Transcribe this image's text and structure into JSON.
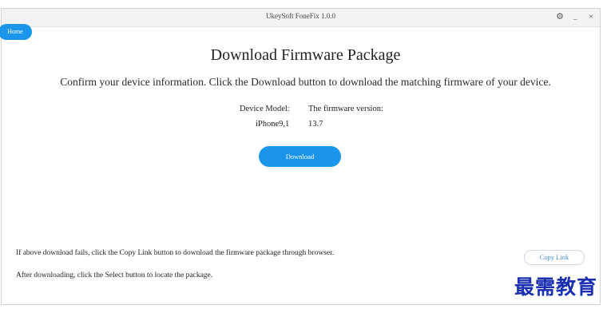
{
  "window": {
    "title": "UkeySoft FoneFix 1.0.0",
    "controls": {
      "settings": "⚙",
      "minimize": "_",
      "close": "×"
    }
  },
  "nav": {
    "home_label": "Home"
  },
  "main": {
    "heading": "Download Firmware Package",
    "subheading": "Confirm your device information. Click the Download button to download the matching firmware of your device.",
    "device_model_label": "Device Model:",
    "firmware_version_label": "The firmware version:",
    "device_model_value": "iPhone9,1",
    "firmware_version_value": "13.7",
    "download_label": "Download"
  },
  "footer": {
    "note_copy": "If above download fails, click the Copy Link button to download the firmware package through browser.",
    "note_select": "After downloading, click the Select button to locate the package.",
    "copy_link_label": "Copy Link"
  },
  "watermark": "最需教育",
  "colors": {
    "accent": "#1a95ea",
    "link": "#4a90d9"
  }
}
